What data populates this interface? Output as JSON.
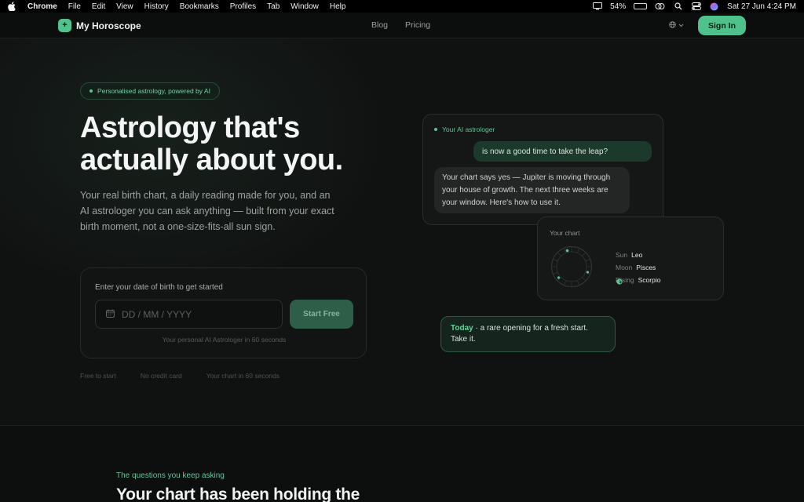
{
  "menubar": {
    "apple_icon": "apple-logo-icon",
    "app": "Chrome",
    "items": [
      "File",
      "Edit",
      "View",
      "History",
      "Bookmarks",
      "Profiles",
      "Tab",
      "Window",
      "Help"
    ],
    "battery_percent": "54%",
    "datetime": "Sat 27 Jun  4:24 PM"
  },
  "header": {
    "brand": "My Horoscope",
    "logo_glyph": "+",
    "nav": [
      "Blog",
      "Pricing"
    ],
    "language_icon": "globe-icon",
    "sign_in": "Sign In"
  },
  "hero": {
    "badge": "Personalised astrology, powered by AI",
    "title": "Astrology that's actually about you.",
    "subtitle": "Your real birth chart, a daily reading made for you, and an AI astrologer you can ask anything — built from your exact birth moment, not a one-size-fits-all sun sign.",
    "signup": {
      "label": "Enter your date of birth to get started",
      "placeholder": "DD / MM / YYYY",
      "button": "Start Free",
      "note": "Your personal AI Astrologer in 60 seconds"
    },
    "perks": [
      "Free to start",
      "No credit card",
      "Your chart in 60 seconds"
    ]
  },
  "chat": {
    "header": "Your AI astrologer",
    "user_message": "is now a good time to take the leap?",
    "ai_message": "Your chart says yes — Jupiter is moving through your house of growth. The next three weeks are your window. Here's how to use it."
  },
  "birth_chart": {
    "title": "Your chart",
    "placements": [
      {
        "icon": "sun-icon",
        "key": "Sun",
        "value": "Leo"
      },
      {
        "icon": "moon-icon",
        "key": "Moon",
        "value": "Pisces"
      },
      {
        "icon": "arrow-up-icon",
        "key": "Rising",
        "value": "Scorpio"
      }
    ]
  },
  "today": {
    "tag": "Today",
    "text": " · a rare opening for a fresh start. Take it."
  },
  "section2": {
    "eyebrow": "The questions you keep asking",
    "title": "Your chart has been holding the"
  },
  "colors": {
    "accent": "#4fc18c",
    "background": "#0d0e0e",
    "card": "#151716"
  }
}
